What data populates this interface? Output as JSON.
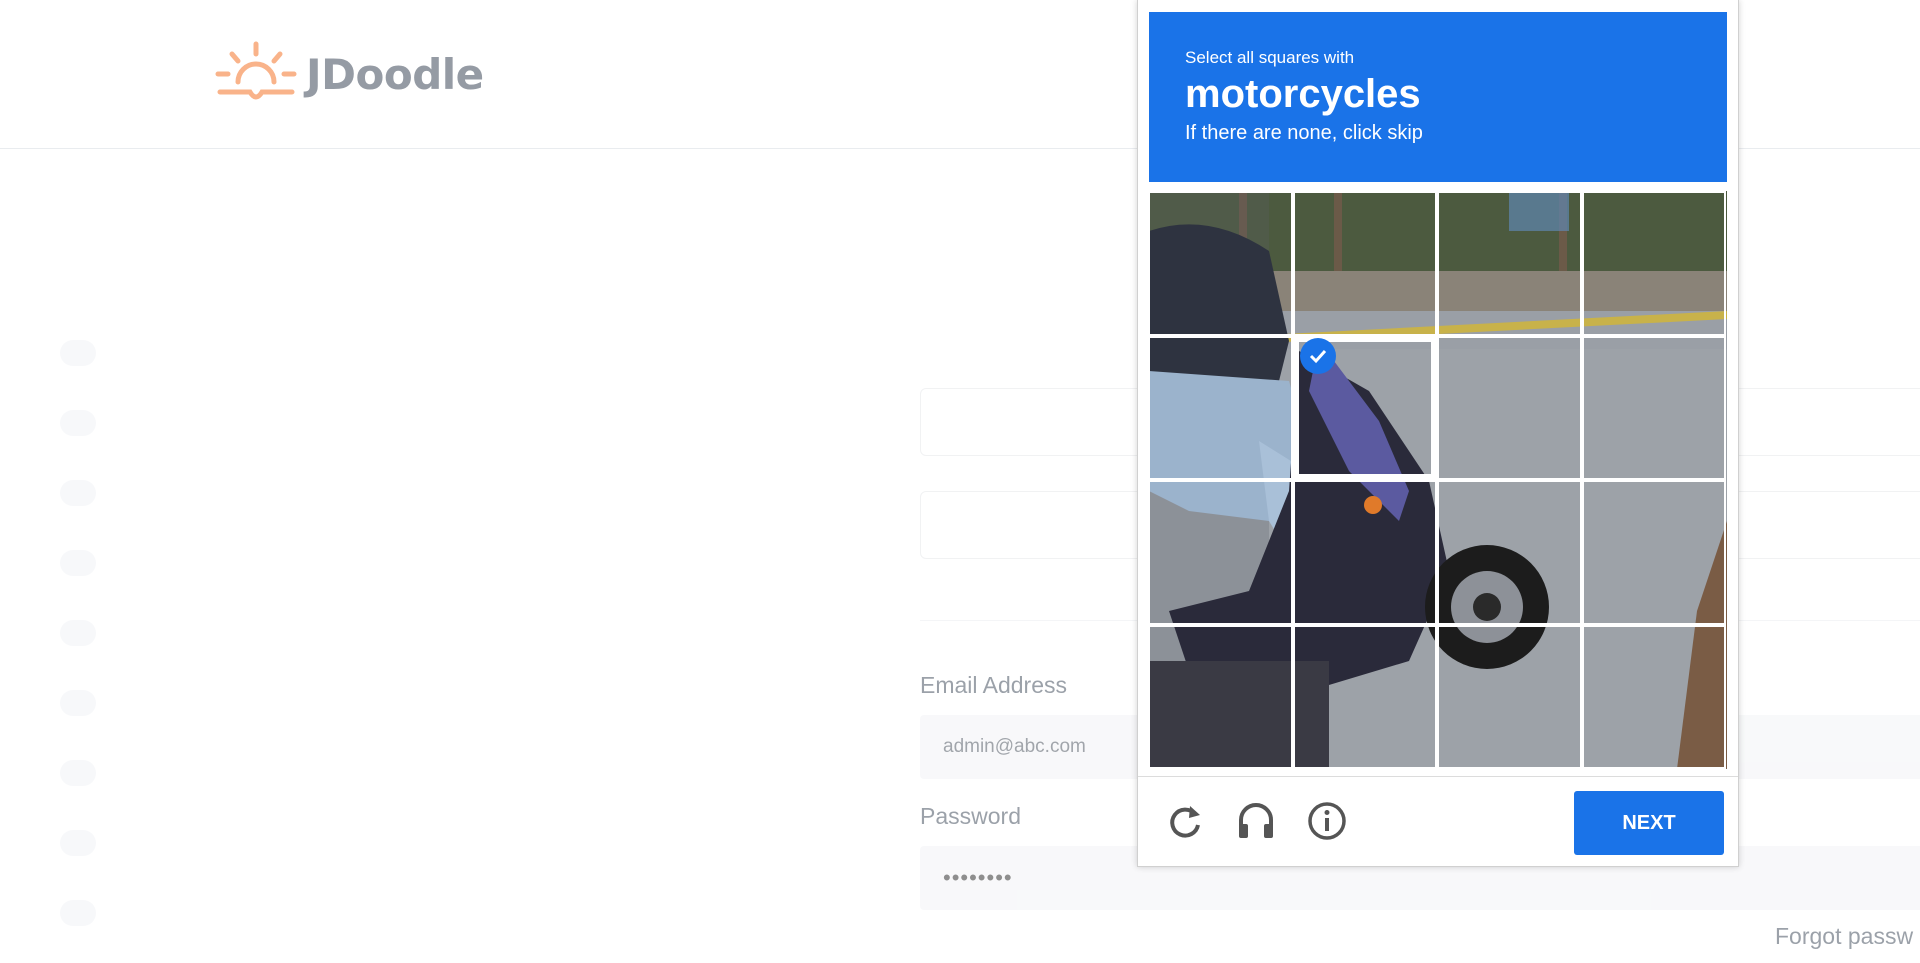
{
  "app": {
    "brand": "JDoodle"
  },
  "login_form": {
    "email_label": "Email Address",
    "email_value": "admin@abc.com",
    "password_label": "Password",
    "password_value": "••••••••",
    "forgot_label": "Forgot passw"
  },
  "captcha": {
    "instruction": "Select all squares with",
    "target": "motorcycles",
    "hint": "If there are none, click skip",
    "grid": {
      "rows": 4,
      "cols": 4,
      "selected_tiles": [
        6
      ]
    },
    "next_label": "NEXT",
    "icons": [
      "reload-icon",
      "audio-challenge-icon",
      "info-icon"
    ],
    "accent_color": "#1a73e8"
  }
}
